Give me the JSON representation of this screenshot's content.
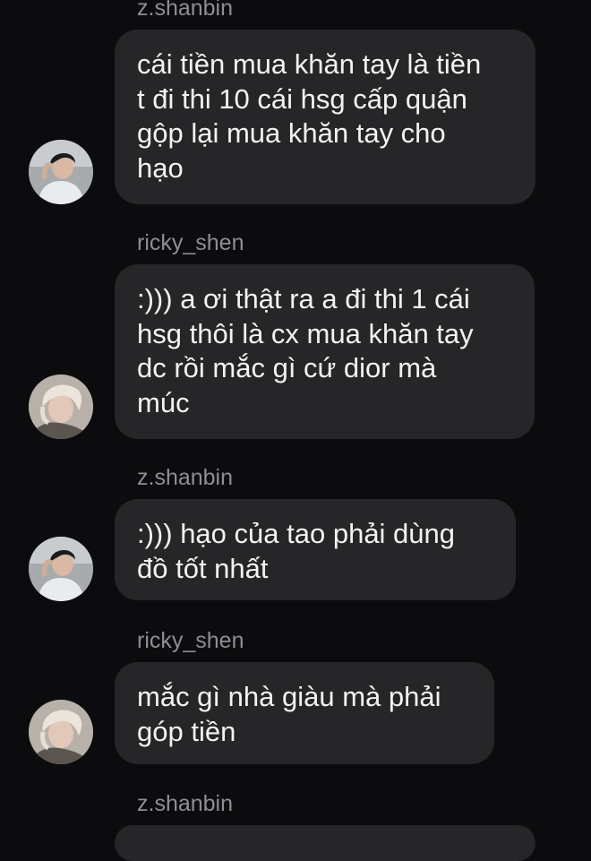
{
  "messages": [
    {
      "sender": "z.shanbin",
      "avatar": "avatar-dark-hair-icon",
      "lines": [
        "cái tiền mua khăn tay là tiền",
        "t đi thi 10 cái hsg cấp quận",
        "gộp lại mua khăn tay cho",
        "hạo"
      ]
    },
    {
      "sender": "ricky_shen",
      "avatar": "avatar-blonde-hair-icon",
      "lines": [
        ":))) a ơi thật ra a đi thi 1 cái",
        "hsg thôi là cx mua khăn tay",
        "dc rồi mắc gì cứ dior mà",
        "múc"
      ]
    },
    {
      "sender": "z.shanbin",
      "avatar": "avatar-dark-hair-icon",
      "lines": [
        ":))) hạo của tao phải dùng",
        "đồ tốt nhất"
      ]
    },
    {
      "sender": "ricky_shen",
      "avatar": "avatar-blonde-hair-icon",
      "lines": [
        "mắc gì nhà giàu mà phải",
        "góp tiền"
      ]
    },
    {
      "sender": "z.shanbin"
    }
  ],
  "colors": {
    "background": "#0c0c0e",
    "bubble": "#262628",
    "sender_text": "#8e8e93",
    "message_text": "#f2f2f2"
  }
}
